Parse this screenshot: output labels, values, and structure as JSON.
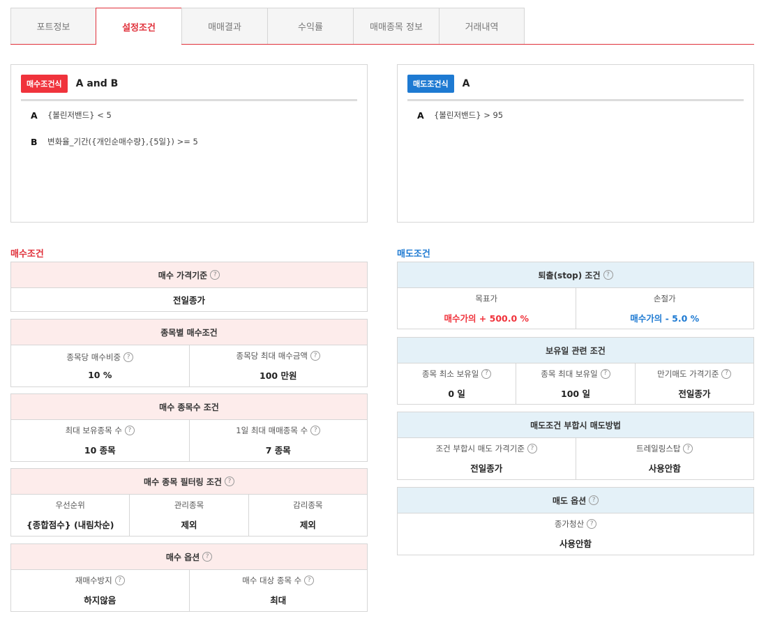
{
  "tabs": [
    "포트정보",
    "설정조건",
    "매매결과",
    "수익률",
    "매매종목 정보",
    "거래내역"
  ],
  "buy_formula": {
    "badge": "매수조건식",
    "expr": "A and B",
    "rows": [
      {
        "key": "A",
        "text": "{볼린저밴드} < 5"
      },
      {
        "key": "B",
        "text": "변화율_기간({개인순매수량},{5일}) >= 5"
      }
    ]
  },
  "sell_formula": {
    "badge": "매도조건식",
    "expr": "A",
    "rows": [
      {
        "key": "A",
        "text": "{볼린저밴드} > 95"
      }
    ]
  },
  "buy_section": {
    "title": "매수조건",
    "price_basis": {
      "header": "매수 가격기준",
      "value": "전일종가"
    },
    "per_stock": {
      "header": "종목별 매수조건",
      "cells": [
        {
          "label": "종목당 매수비중",
          "value": "10 %"
        },
        {
          "label": "종목당 최대 매수금액",
          "value": "100 만원"
        }
      ]
    },
    "count": {
      "header": "매수 종목수 조건",
      "cells": [
        {
          "label": "최대 보유종목 수",
          "value": "10 종목"
        },
        {
          "label": "1일 최대 매매종목 수",
          "value": "7 종목"
        }
      ]
    },
    "filter": {
      "header": "매수 종목 필터링 조건",
      "cells": [
        {
          "label": "우선순위",
          "value": "{종합점수} (내림차순)"
        },
        {
          "label": "관리종목",
          "value": "제외"
        },
        {
          "label": "감리종목",
          "value": "제외"
        }
      ]
    },
    "options": {
      "header": "매수 옵션",
      "cells": [
        {
          "label": "재매수방지",
          "value": "하지않음"
        },
        {
          "label": "매수 대상 종목 수",
          "value": "최대"
        }
      ]
    }
  },
  "sell_section": {
    "title": "매도조건",
    "stop": {
      "header": "퇴출(stop) 조건",
      "cells": [
        {
          "label": "목표가",
          "value": "매수가의 + 500.0 %"
        },
        {
          "label": "손절가",
          "value": "매수가의 - 5.0 %"
        }
      ]
    },
    "holding": {
      "header": "보유일 관련 조건",
      "cells": [
        {
          "label": "종목 최소 보유일",
          "value": "0 일"
        },
        {
          "label": "종목 최대 보유일",
          "value": "100 일"
        },
        {
          "label": "만기매도 가격기준",
          "value": "전일종가"
        }
      ]
    },
    "method": {
      "header": "매도조건 부합시 매도방법",
      "cells": [
        {
          "label": "조건 부합시 매도 가격기준",
          "value": "전일종가"
        },
        {
          "label": "트레일링스탑",
          "value": "사용안함"
        }
      ]
    },
    "options": {
      "header": "매도 옵션",
      "cells": [
        {
          "label": "종가청산",
          "value": "사용안함"
        }
      ]
    }
  },
  "help_glyph": "?",
  "colors": {
    "accent_red": "#f0333c",
    "accent_blue": "#1e7ad2",
    "buy_header_bg": "#fdeceb",
    "sell_header_bg": "#e4f1f8"
  }
}
